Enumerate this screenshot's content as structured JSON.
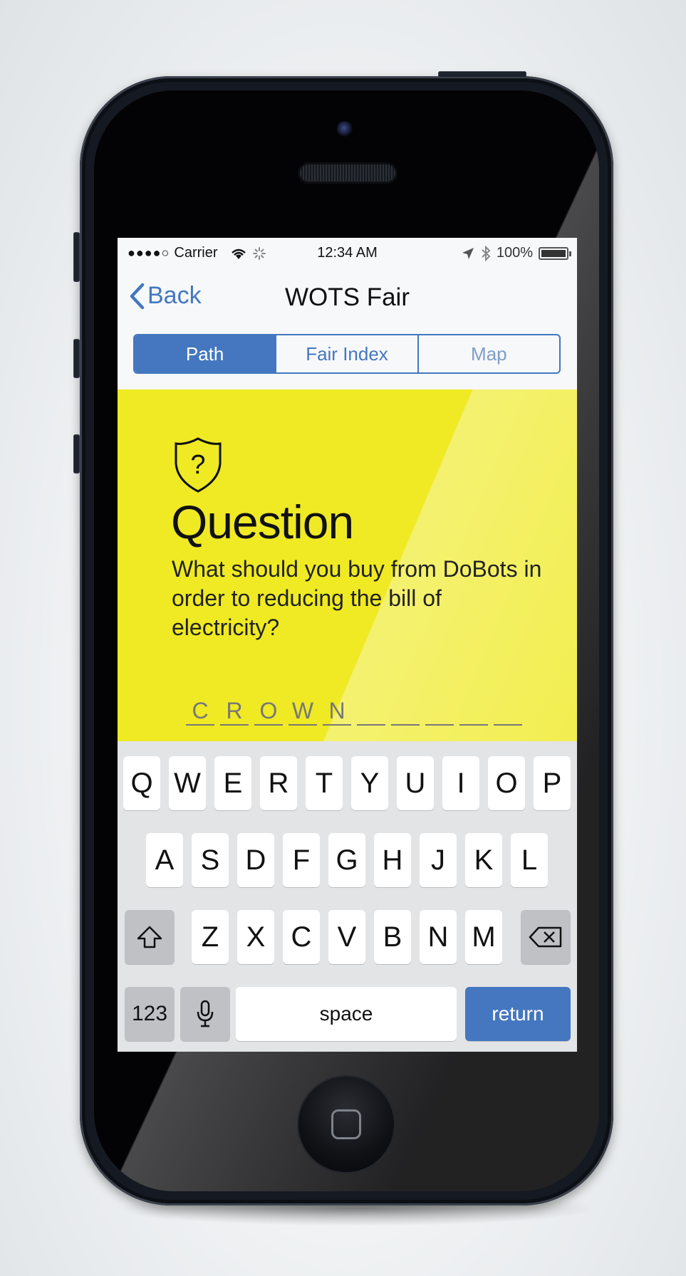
{
  "status_bar": {
    "signal": "●●●●○",
    "carrier": "Carrier",
    "time": "12:34 AM",
    "battery_percent": "100%",
    "battery_level": 1.0
  },
  "nav": {
    "back_label": "Back",
    "title": "WOTS Fair"
  },
  "segments": [
    "Path",
    "Fair Index",
    "Map"
  ],
  "question": {
    "heading": "Question",
    "icon_glyph": "?",
    "text": "What should you buy from DoBots in order to reducing the bill of electricity?",
    "answer_slots": [
      "C",
      "R",
      "O",
      "W",
      "N",
      "",
      "",
      "",
      "",
      "",
      ""
    ]
  },
  "keyboard": {
    "row1": [
      "Q",
      "W",
      "E",
      "R",
      "T",
      "Y",
      "U",
      "I",
      "O",
      "P"
    ],
    "row2": [
      "A",
      "S",
      "D",
      "F",
      "G",
      "H",
      "J",
      "K",
      "L"
    ],
    "row3": [
      "Z",
      "X",
      "C",
      "V",
      "B",
      "N",
      "M"
    ],
    "numbers_label": "123",
    "space_label": "space",
    "return_label": "return"
  },
  "colors": {
    "accent": "#4477bf",
    "question_bg": "#efea24"
  }
}
